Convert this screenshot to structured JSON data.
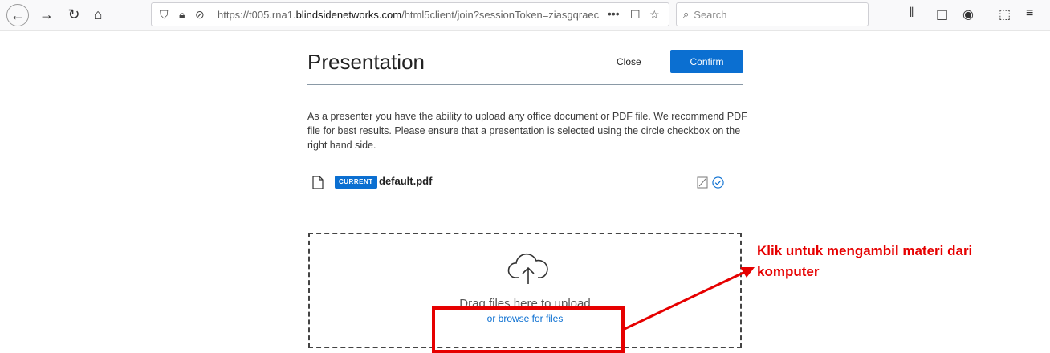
{
  "browser": {
    "url_prefix": "https://t005.rna1.",
    "url_domain": "blindsidenetworks.com",
    "url_suffix": "/html5client/join?sessionToken=ziasgqraec",
    "url_more": "•••",
    "search_placeholder": "Search"
  },
  "modal": {
    "title": "Presentation",
    "close_label": "Close",
    "confirm_label": "Confirm",
    "description": "As a presenter you have the ability to upload any office document or PDF file. We recommend PDF file for best results. Please ensure that a presentation is selected using the circle checkbox on the right hand side.",
    "file": {
      "badge": "CURRENT",
      "name": "default.pdf"
    },
    "dropzone": {
      "drag_text": "Drag files here to upload",
      "browse_text": "or browse for files"
    }
  },
  "annotation": {
    "line1": "Klik untuk mengambil materi dari",
    "line2": "komputer",
    "color": "#e60000"
  },
  "colors": {
    "accent": "#0b6fd1"
  }
}
